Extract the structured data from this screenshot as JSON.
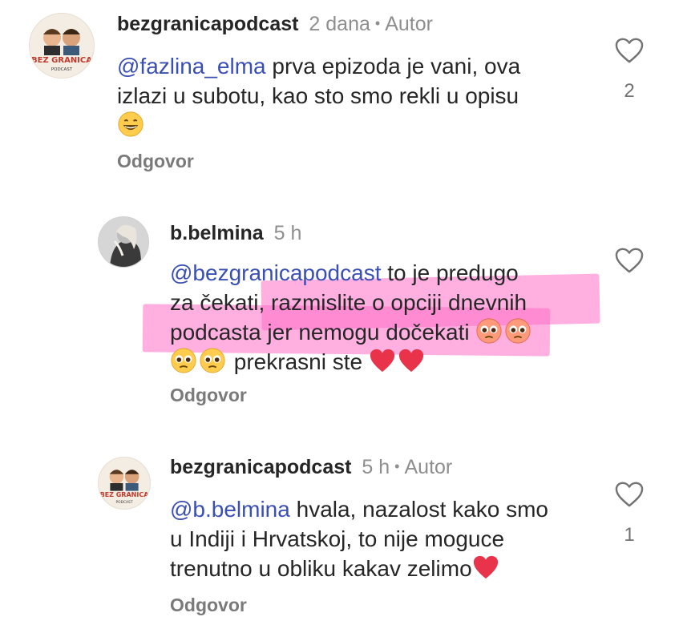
{
  "comments": [
    {
      "username": "bezgranicapodcast",
      "time": "2 dana",
      "separator": "•",
      "author_badge": "Autor",
      "mention": "@fazlina_elma",
      "line1_rest": " prva epizoda je vani, ova",
      "line2": "izlazi u subotu, kao sto smo rekli u opisu",
      "line3_emoji": "grinning-face-emoji",
      "reply_label": "Odgovor",
      "like_count": "2",
      "avatar_text": "BEZ GRANICA",
      "avatar_subtext": "PODCAST"
    },
    {
      "username": "b.belmina",
      "time": "5 h",
      "mention": "@bezgranicapodcast",
      "line1_rest": " to je predugo",
      "line2": "za čekati, razmislite o opciji dnevnih",
      "line3": "podcasta jer nemogu dočekati ",
      "line4_text": " prekrasni ste ",
      "reply_label": "Odgovor"
    },
    {
      "username": "bezgranicapodcast",
      "time": "5 h",
      "separator": "•",
      "author_badge": "Autor",
      "mention": "@b.belmina",
      "line1_rest": " hvala, nazalost kako smo",
      "line2": "u Indiji i Hrvatskoj, to nije moguce",
      "line3": "trenutno u obliku kakav zelimo",
      "reply_label": "Odgovor",
      "like_count": "1",
      "avatar_text": "BEZ GRANICA",
      "avatar_subtext": "PODCAST"
    }
  ],
  "colors": {
    "mention": "#3a4fb5",
    "highlight": "#ff6fc7",
    "muted": "#8e8e8e",
    "heart_red": "#e8334a"
  }
}
